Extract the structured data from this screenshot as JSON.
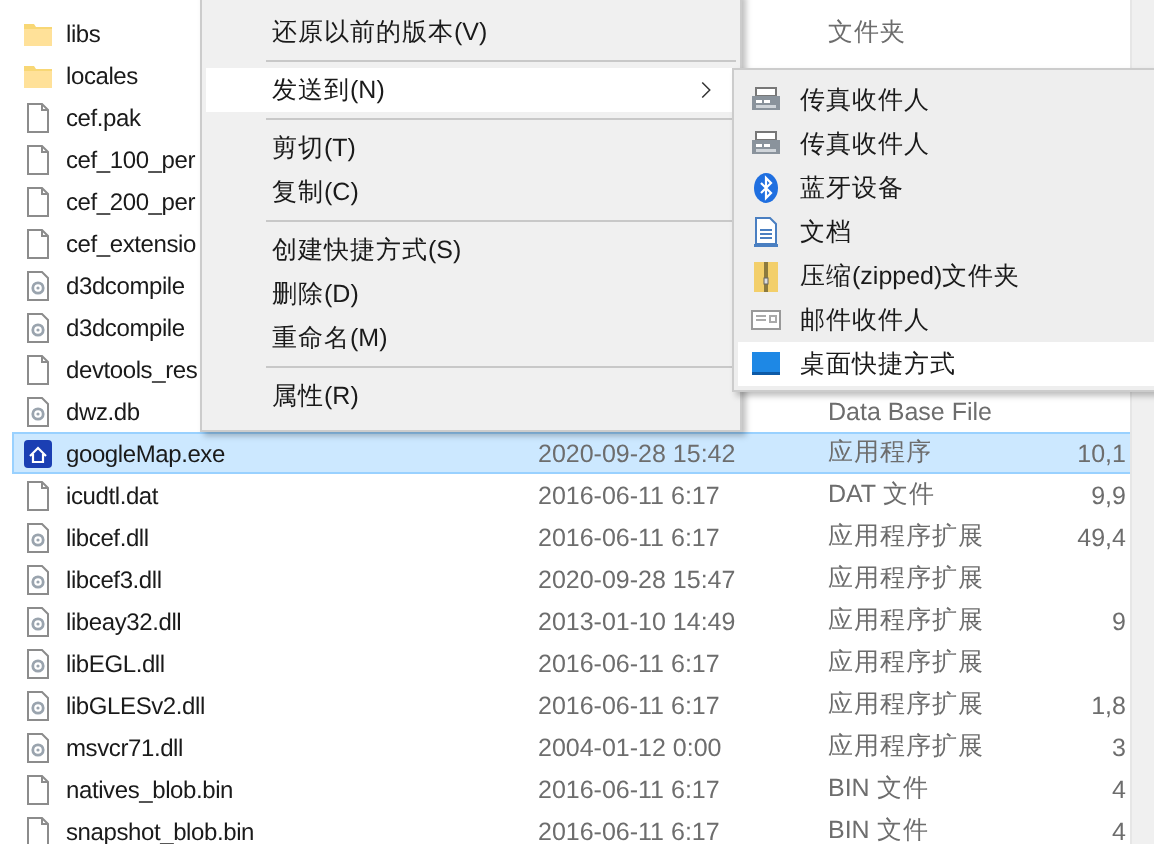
{
  "files": [
    {
      "name": "libs",
      "kind": "folder",
      "type": "文件夹",
      "selected": false
    },
    {
      "name": "locales",
      "kind": "folder",
      "selected": false
    },
    {
      "name": "cef.pak",
      "kind": "file",
      "selected": false
    },
    {
      "name": "cef_100_per",
      "kind": "file",
      "selected": false
    },
    {
      "name": "cef_200_per",
      "kind": "file",
      "selected": false
    },
    {
      "name": "cef_extensio",
      "kind": "file",
      "selected": false
    },
    {
      "name": "d3dcompile",
      "kind": "dll",
      "selected": false
    },
    {
      "name": "d3dcompile",
      "kind": "dll",
      "selected": false
    },
    {
      "name": "devtools_res",
      "kind": "file",
      "selected": false
    },
    {
      "name": "dwz.db",
      "kind": "dll",
      "type": "Data Base File",
      "selected": false
    },
    {
      "name": "googleMap.exe",
      "kind": "exe",
      "date": "2020-09-28 15:42",
      "type": "应用程序",
      "size": "10,1",
      "selected": true
    },
    {
      "name": "icudtl.dat",
      "kind": "file",
      "date": "2016-06-11 6:17",
      "type": "DAT 文件",
      "size": "9,9",
      "selected": false
    },
    {
      "name": "libcef.dll",
      "kind": "dll",
      "date": "2016-06-11 6:17",
      "type": "应用程序扩展",
      "size": "49,4",
      "selected": false
    },
    {
      "name": "libcef3.dll",
      "kind": "dll",
      "date": "2020-09-28 15:47",
      "type": "应用程序扩展",
      "selected": false
    },
    {
      "name": "libeay32.dll",
      "kind": "dll",
      "date": "2013-01-10 14:49",
      "type": "应用程序扩展",
      "size": "9",
      "selected": false
    },
    {
      "name": "libEGL.dll",
      "kind": "dll",
      "date": "2016-06-11 6:17",
      "type": "应用程序扩展",
      "selected": false
    },
    {
      "name": "libGLESv2.dll",
      "kind": "dll",
      "date": "2016-06-11 6:17",
      "type": "应用程序扩展",
      "size": "1,8",
      "selected": false
    },
    {
      "name": "msvcr71.dll",
      "kind": "dll",
      "date": "2004-01-12 0:00",
      "type": "应用程序扩展",
      "size": "3",
      "selected": false
    },
    {
      "name": "natives_blob.bin",
      "kind": "file",
      "date": "2016-06-11 6:17",
      "type": "BIN 文件",
      "size": "4",
      "selected": false
    },
    {
      "name": "snapshot_blob.bin",
      "kind": "file",
      "date": "2016-06-11 6:17",
      "type": "BIN 文件",
      "size": "4",
      "selected": false
    }
  ],
  "context_menu": [
    {
      "kind": "item",
      "label": "还原以前的版本(V)",
      "selected": false
    },
    {
      "kind": "separator"
    },
    {
      "kind": "item",
      "label": "发送到(N)",
      "selected": true,
      "submenu": true
    },
    {
      "kind": "separator"
    },
    {
      "kind": "item",
      "label": "剪切(T)",
      "selected": false
    },
    {
      "kind": "item",
      "label": "复制(C)",
      "selected": false
    },
    {
      "kind": "separator"
    },
    {
      "kind": "item",
      "label": "创建快捷方式(S)",
      "selected": false
    },
    {
      "kind": "item",
      "label": "删除(D)",
      "selected": false
    },
    {
      "kind": "item",
      "label": "重命名(M)",
      "selected": false
    },
    {
      "kind": "separator"
    },
    {
      "kind": "item",
      "label": "属性(R)",
      "selected": false
    }
  ],
  "send_to_menu": [
    {
      "kind": "fax",
      "label": "传真收件人",
      "selected": false
    },
    {
      "kind": "fax",
      "label": "传真收件人",
      "selected": false
    },
    {
      "kind": "bluetooth",
      "label": "蓝牙设备",
      "selected": false
    },
    {
      "kind": "document",
      "label": "文档",
      "selected": false
    },
    {
      "kind": "zip",
      "label": "压缩(zipped)文件夹",
      "selected": false
    },
    {
      "kind": "mail",
      "label": "邮件收件人",
      "selected": false
    },
    {
      "kind": "desktop",
      "label": "桌面快捷方式",
      "selected": true
    }
  ]
}
